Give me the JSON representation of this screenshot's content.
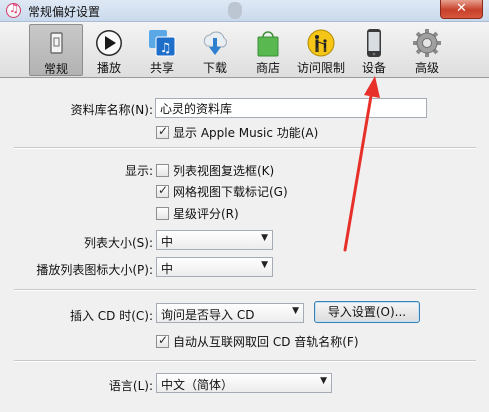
{
  "window": {
    "title": "常规偏好设置",
    "close_label": "✕"
  },
  "toolbar": {
    "items": [
      {
        "label": "常规",
        "icon": "general-icon",
        "active": true
      },
      {
        "label": "播放",
        "icon": "play-icon",
        "active": false
      },
      {
        "label": "共享",
        "icon": "sharing-icon",
        "active": false
      },
      {
        "label": "下载",
        "icon": "download-icon",
        "active": false
      },
      {
        "label": "商店",
        "icon": "store-bag-icon",
        "active": false
      },
      {
        "label": "访问限制",
        "icon": "parental-restrictions-icon",
        "active": false
      },
      {
        "label": "设备",
        "icon": "device-phone-icon",
        "active": false
      },
      {
        "label": "高级",
        "icon": "gear-icon",
        "active": false
      }
    ]
  },
  "general": {
    "library_name_label": "资料库名称(N):",
    "library_name_value": "心灵的资料库",
    "show_apple_music_label": "显示 Apple Music 功能(A)",
    "show_apple_music_checked": true,
    "display_label": "显示:",
    "list_view_checkboxes_label": "列表视图复选框(K)",
    "list_view_checkboxes_checked": false,
    "grid_view_download_badges_label": "网格视图下载标记(G)",
    "grid_view_download_badges_checked": true,
    "star_ratings_label": "星级评分(R)",
    "star_ratings_checked": false,
    "list_size_label": "列表大小(S):",
    "list_size_value": "中",
    "playlist_icon_size_label": "播放列表图标大小(P):",
    "playlist_icon_size_value": "中",
    "insert_cd_label": "插入 CD 时(C):",
    "insert_cd_value": "询问是否导入 CD",
    "import_settings_button": "导入设置(O)...",
    "auto_retrieve_cd_names_label": "自动从互联网取回 CD 音轨名称(F)",
    "auto_retrieve_cd_names_checked": true,
    "language_label": "语言(L):",
    "language_value": "中文（简体）"
  },
  "colors": {
    "annotation_arrow": "#e8302a",
    "title_bar": "#c9d9ec",
    "close_button": "#c7402a"
  }
}
